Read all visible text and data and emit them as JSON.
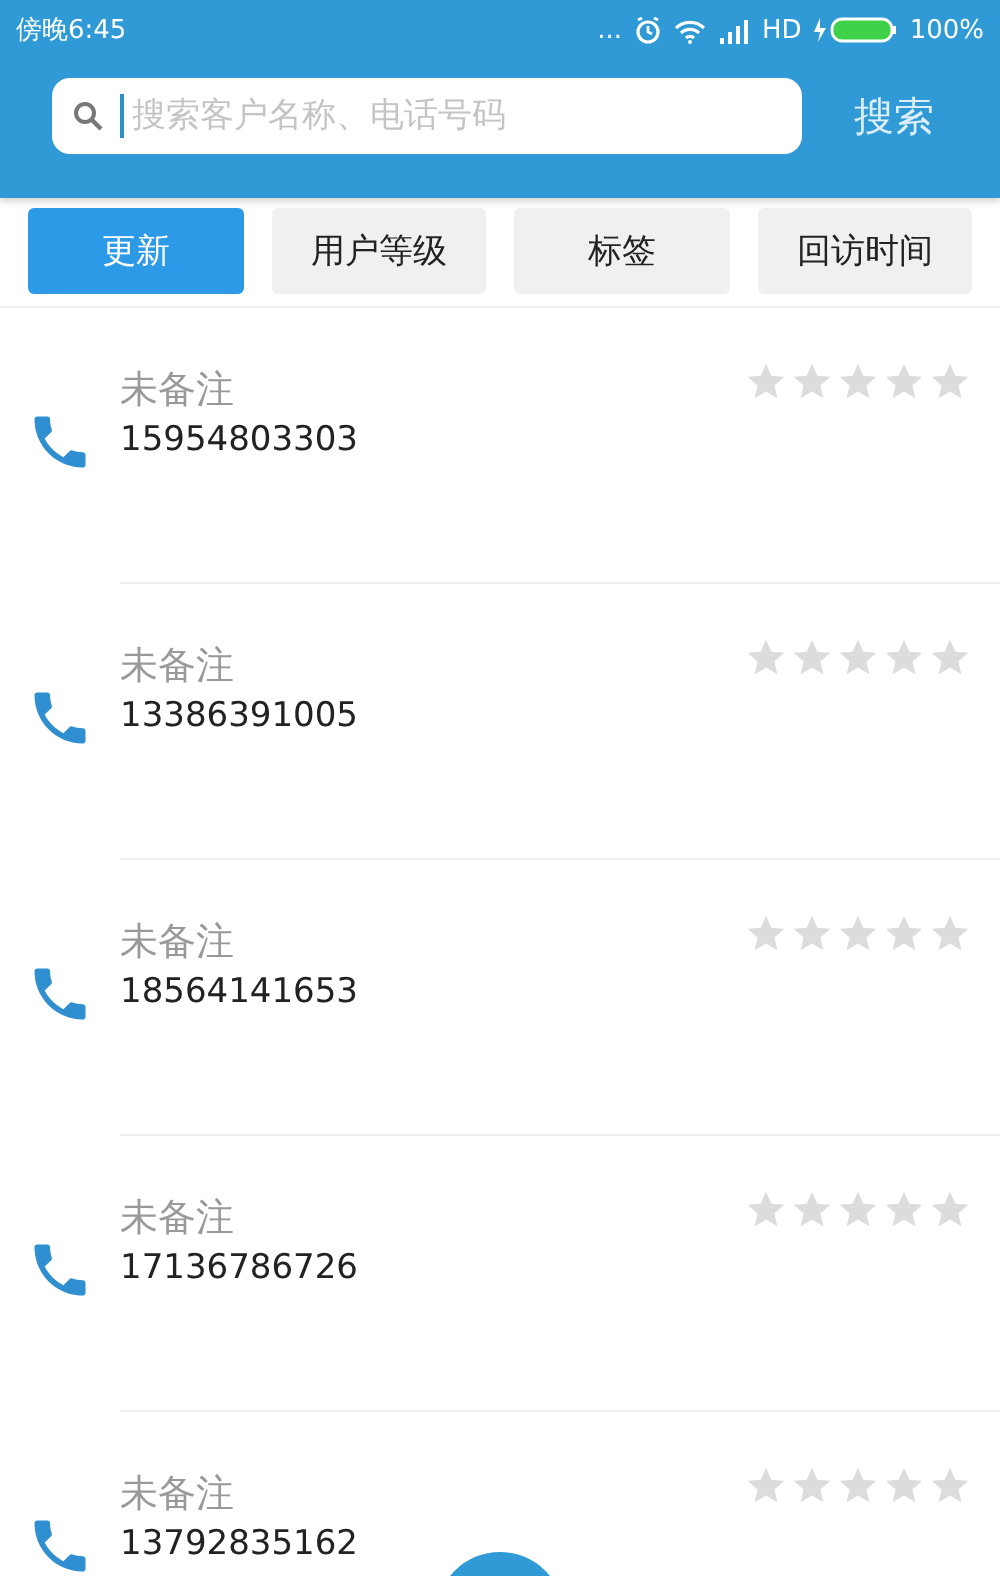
{
  "status_bar": {
    "time": "傍晚6:45",
    "dots": "...",
    "network": "HD",
    "battery": "100%"
  },
  "search": {
    "placeholder": "搜索客户名称、电话号码",
    "button": "搜索"
  },
  "tabs": [
    {
      "label": "更新",
      "selected": true
    },
    {
      "label": "用户等级",
      "selected": false
    },
    {
      "label": "标签",
      "selected": false
    },
    {
      "label": "回访时间",
      "selected": false
    }
  ],
  "contacts": [
    {
      "note": "未备注",
      "phone": "15954803303",
      "stars": 0
    },
    {
      "note": "未备注",
      "phone": "13386391005",
      "stars": 0
    },
    {
      "note": "未备注",
      "phone": "18564141653",
      "stars": 0
    },
    {
      "note": "未备注",
      "phone": "17136786726",
      "stars": 0
    },
    {
      "note": "未备注",
      "phone": "13792835162",
      "stars": 0
    }
  ]
}
